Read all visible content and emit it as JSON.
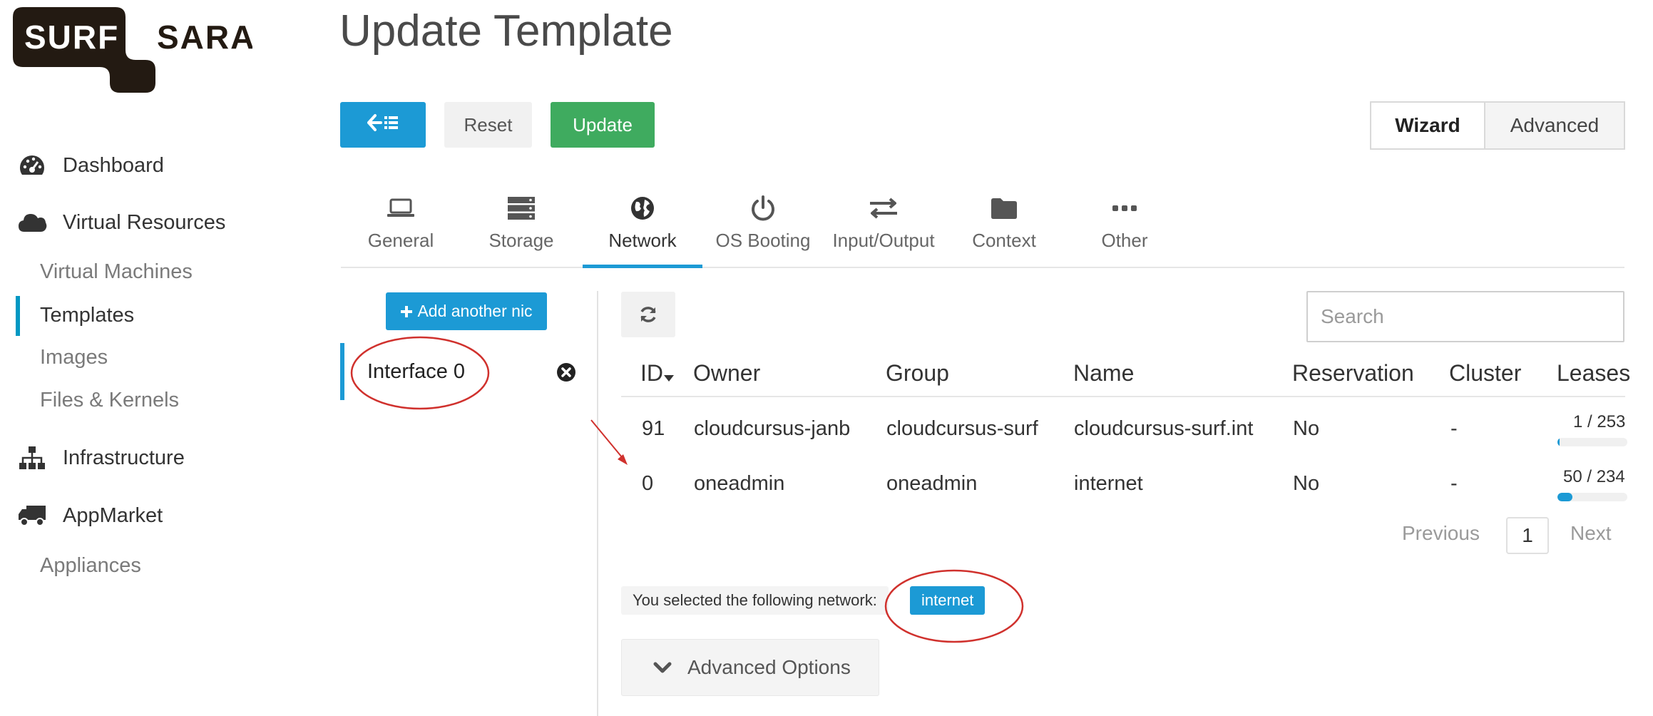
{
  "brand": {
    "logo_left": "SURF",
    "logo_right": "SARA",
    "logo_color": "#231a12"
  },
  "sidebar": {
    "items": [
      {
        "label": "Dashboard",
        "icon": "dashboard-icon"
      },
      {
        "label": "Virtual Resources",
        "icon": "cloud-icon"
      },
      {
        "label": "Virtual Machines"
      },
      {
        "label": "Templates",
        "active": true
      },
      {
        "label": "Images"
      },
      {
        "label": "Files & Kernels"
      },
      {
        "label": "Infrastructure",
        "icon": "sitemap-icon"
      },
      {
        "label": "AppMarket",
        "icon": "truck-icon"
      },
      {
        "label": "Appliances"
      }
    ]
  },
  "header": {
    "title": "Update Template",
    "back_icon": "arrow-left-list-icon",
    "reset_label": "Reset",
    "update_label": "Update",
    "mode_wizard": "Wizard",
    "mode_advanced": "Advanced"
  },
  "tabs": [
    {
      "label": "General",
      "icon": "laptop-icon"
    },
    {
      "label": "Storage",
      "icon": "storage-icon"
    },
    {
      "label": "Network",
      "icon": "globe-icon",
      "active": true
    },
    {
      "label": "OS Booting",
      "icon": "power-icon"
    },
    {
      "label": "Input/Output",
      "icon": "exchange-icon"
    },
    {
      "label": "Context",
      "icon": "folder-icon"
    },
    {
      "label": "Other",
      "icon": "ellipsis-icon"
    }
  ],
  "network": {
    "add_nic_label": "Add another nic",
    "interface_label": "Interface 0",
    "search_placeholder": "Search",
    "columns": [
      "ID",
      "Owner",
      "Group",
      "Name",
      "Reservation",
      "Cluster",
      "Leases"
    ],
    "rows": [
      {
        "id": "91",
        "owner": "cloudcursus-janb",
        "group": "cloudcursus-surf",
        "name": "cloudcursus-surf.int",
        "reservation": "No",
        "cluster": "-",
        "leases": "1 / 253",
        "lease_fraction": 0.004
      },
      {
        "id": "0",
        "owner": "oneadmin",
        "group": "oneadmin",
        "name": "internet",
        "reservation": "No",
        "cluster": "-",
        "leases": "50 / 234",
        "lease_fraction": 0.214
      }
    ],
    "pager": {
      "previous": "Previous",
      "page": "1",
      "next": "Next"
    },
    "selected_text": "You selected the following network:",
    "selected_network": "internet",
    "advanced_options": "Advanced Options"
  },
  "colors": {
    "primary": "#1c9ad5",
    "success": "#3fab5f",
    "annotation": "#d0312d"
  }
}
